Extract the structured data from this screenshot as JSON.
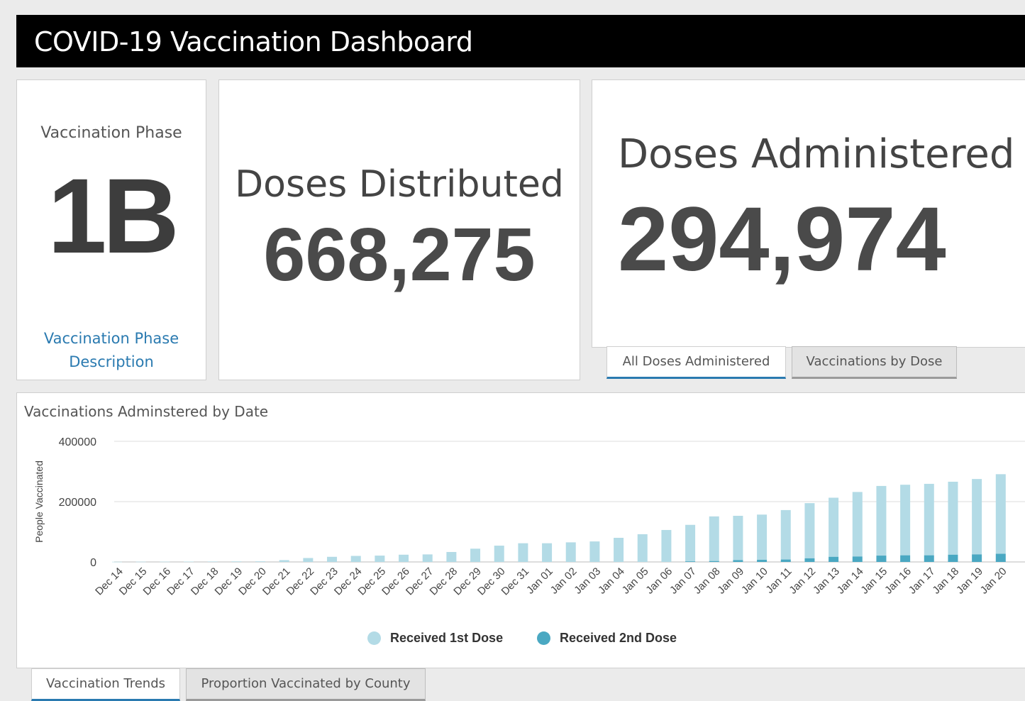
{
  "header": {
    "title": "COVID-19 Vaccination Dashboard"
  },
  "phase": {
    "label": "Vaccination Phase",
    "value": "1B",
    "link": "Vaccination Phase Description"
  },
  "distributed": {
    "label": "Doses Distributed",
    "value": "668,275"
  },
  "administered": {
    "label": "Doses Administered",
    "value": "294,974",
    "tabs": [
      {
        "label": "All Doses Administered",
        "active": true
      },
      {
        "label": "Vaccinations by Dose",
        "active": false
      }
    ]
  },
  "chart": {
    "title": "Vaccinations Adminstered by Date",
    "tabs": [
      {
        "label": "Vaccination Trends",
        "active": true
      },
      {
        "label": "Proportion Vaccinated by County",
        "active": false
      }
    ]
  },
  "chart_data": {
    "type": "bar",
    "stacked": true,
    "title": "Vaccinations Adminstered by Date",
    "xlabel": "",
    "ylabel": "People Vaccinated",
    "ylim": [
      0,
      400000
    ],
    "yticks": [
      "0",
      "200000",
      "400000"
    ],
    "grid": true,
    "legend_position": "bottom",
    "categories": [
      "Dec 14",
      "Dec 15",
      "Dec 16",
      "Dec 17",
      "Dec 18",
      "Dec 19",
      "Dec 20",
      "Dec 21",
      "Dec 22",
      "Dec 23",
      "Dec 24",
      "Dec 25",
      "Dec 26",
      "Dec 27",
      "Dec 28",
      "Dec 29",
      "Dec 30",
      "Dec 31",
      "Jan 01",
      "Jan 02",
      "Jan 03",
      "Jan 04",
      "Jan 05",
      "Jan 06",
      "Jan 07",
      "Jan 08",
      "Jan 09",
      "Jan 10",
      "Jan 11",
      "Jan 12",
      "Jan 13",
      "Jan 14",
      "Jan 15",
      "Jan 16",
      "Jan 17",
      "Jan 18",
      "Jan 19",
      "Jan 20"
    ],
    "series": [
      {
        "name": "Received 1st Dose",
        "color": "#b3dbe6",
        "values": [
          500,
          800,
          1000,
          1200,
          1500,
          1800,
          2000,
          6000,
          13000,
          17000,
          20000,
          21000,
          24000,
          25000,
          33000,
          44000,
          54000,
          62000,
          62000,
          65000,
          68000,
          80000,
          92000,
          106000,
          121000,
          148000,
          147000,
          150000,
          164000,
          183000,
          196000,
          214000,
          231000,
          234000,
          237000,
          242000,
          250000,
          264000
        ]
      },
      {
        "name": "Received 2nd Dose",
        "color": "#4aa8c2",
        "values": [
          0,
          0,
          0,
          0,
          0,
          0,
          0,
          0,
          0,
          0,
          0,
          0,
          0,
          0,
          0,
          0,
          0,
          0,
          0,
          0,
          0,
          0,
          0,
          0,
          2000,
          3000,
          6000,
          7000,
          8000,
          12000,
          17000,
          18000,
          21000,
          22000,
          22000,
          24000,
          25000,
          27000
        ]
      }
    ]
  }
}
